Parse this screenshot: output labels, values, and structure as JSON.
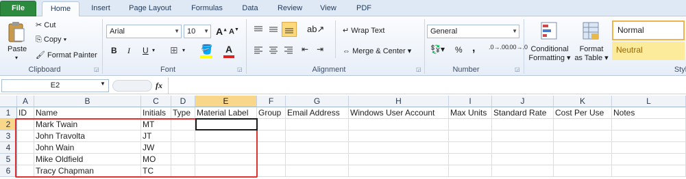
{
  "tabs": [
    "File",
    "Home",
    "Insert",
    "Page Layout",
    "Formulas",
    "Data",
    "Review",
    "View",
    "PDF"
  ],
  "clipboard": {
    "paste": "Paste",
    "cut": "Cut",
    "copy": "Copy",
    "format_painter": "Format Painter",
    "group": "Clipboard"
  },
  "font": {
    "name": "Arial",
    "size": "10",
    "group": "Font",
    "bold": "B",
    "italic": "I",
    "underline": "U"
  },
  "alignment": {
    "wrap": "Wrap Text",
    "merge": "Merge & Center",
    "group": "Alignment"
  },
  "number": {
    "format": "General",
    "group": "Number",
    "percent": "%",
    "comma": ",",
    "inc": ".0→.00",
    "dec": ".00→.0"
  },
  "styles": {
    "conditional1": "Conditional",
    "conditional2": "Formatting",
    "format1": "Format",
    "format2": "as Table",
    "normal": "Normal",
    "neutral": "Neutral",
    "group": "Styl"
  },
  "formula_bar": {
    "name_box": "E2",
    "fx": "fx",
    "value": ""
  },
  "columns": [
    "A",
    "B",
    "C",
    "D",
    "E",
    "F",
    "G",
    "H",
    "I",
    "J",
    "K",
    "L"
  ],
  "rows": [
    {
      "num": "1",
      "cells": [
        "ID",
        "Name",
        "Initials",
        "Type",
        "Material Label",
        "Group",
        "Email Address",
        "Windows User Account",
        "Max Units",
        "Standard Rate",
        "Cost Per Use",
        "Notes"
      ]
    },
    {
      "num": "2",
      "cells": [
        "",
        "Mark Twain",
        "MT",
        "",
        "",
        "",
        "",
        "",
        "",
        "",
        "",
        ""
      ]
    },
    {
      "num": "3",
      "cells": [
        "",
        "John Travolta",
        "JT",
        "",
        "",
        "",
        "",
        "",
        "",
        "",
        "",
        ""
      ]
    },
    {
      "num": "4",
      "cells": [
        "",
        "John Wain",
        "JW",
        "",
        "",
        "",
        "",
        "",
        "",
        "",
        "",
        ""
      ]
    },
    {
      "num": "5",
      "cells": [
        "",
        "Mike Oldfield",
        "MO",
        "",
        "",
        "",
        "",
        "",
        "",
        "",
        "",
        ""
      ]
    },
    {
      "num": "6",
      "cells": [
        "",
        "Tracy Chapman",
        "TC",
        "",
        "",
        "",
        "",
        "",
        "",
        "",
        "",
        ""
      ]
    }
  ],
  "colors": {
    "file_tab": "#2b8a3e",
    "selection": "#f8d68a",
    "highlight_box": "#e03030"
  }
}
